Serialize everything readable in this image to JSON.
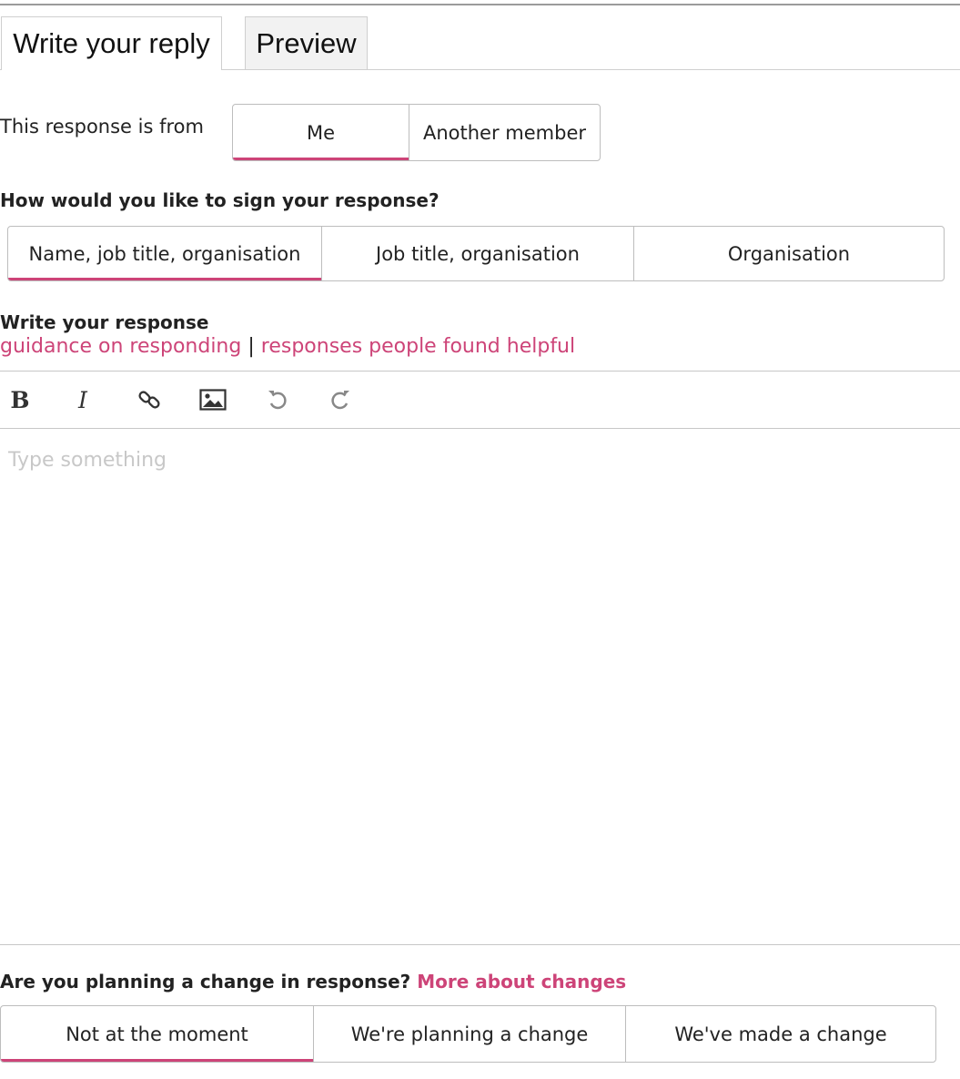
{
  "tabs": {
    "write": "Write your reply",
    "preview": "Preview"
  },
  "from": {
    "label": "This response is from",
    "options": [
      "Me",
      "Another member"
    ],
    "selected": "Me"
  },
  "sign": {
    "question": "How would you like to sign your response?",
    "options": [
      "Name, job title, organisation",
      "Job title, organisation",
      "Organisation"
    ],
    "selected": "Name, job title, organisation"
  },
  "response": {
    "heading": "Write your response",
    "guidance_link": "guidance on responding",
    "separator": "|",
    "helpful_link": "responses people found helpful"
  },
  "toolbar": {
    "icons": [
      "bold-icon",
      "italic-icon",
      "link-icon",
      "image-icon",
      "undo-icon",
      "redo-icon"
    ]
  },
  "editor": {
    "placeholder": "Type something"
  },
  "change": {
    "question": "Are you planning a change in response?",
    "more_link": "More about changes",
    "options": [
      "Not at the moment",
      "We're planning a change",
      "We've made a change"
    ],
    "selected": "Not at the moment"
  },
  "colors": {
    "accent": "#cd4478",
    "border": "#bdbdbd",
    "placeholder": "#c8c8c8"
  }
}
